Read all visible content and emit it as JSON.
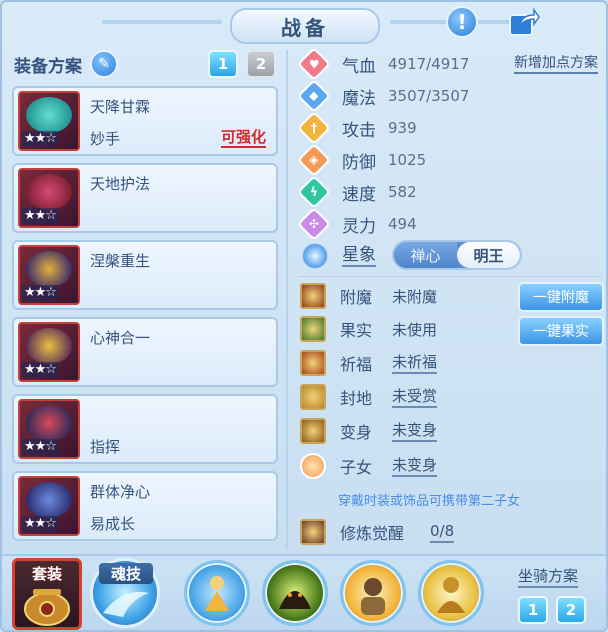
{
  "title": "战备",
  "equip_panel": {
    "label": "装备方案",
    "plan_tabs": [
      "1",
      "2"
    ],
    "items": [
      {
        "name": "天降甘霖",
        "sub": "妙手",
        "upgrade": "可强化",
        "stars": "★★☆",
        "icon": "sword-icon",
        "colors": [
          "#1f8f8f",
          "#62e0d2"
        ]
      },
      {
        "name": "天地护法",
        "sub": "",
        "upgrade": "",
        "stars": "★★☆",
        "icon": "helmet-icon",
        "colors": [
          "#7a1e2e",
          "#d64a7a"
        ]
      },
      {
        "name": "涅槃重生",
        "sub": "",
        "upgrade": "",
        "stars": "★★☆",
        "icon": "armor-icon",
        "colors": [
          "#3a2a6a",
          "#e0b040"
        ]
      },
      {
        "name": "心神合一",
        "sub": "",
        "upgrade": "",
        "stars": "★★☆",
        "icon": "necklace-icon",
        "colors": [
          "#5a2a5a",
          "#e8c040"
        ]
      },
      {
        "name": "",
        "sub": "指挥",
        "upgrade": "",
        "stars": "★★☆",
        "icon": "belt-icon",
        "colors": [
          "#2a2a5a",
          "#d84a5a"
        ]
      },
      {
        "name": "群体净心",
        "sub": "易成长",
        "upgrade": "",
        "stars": "★★☆",
        "icon": "boots-icon",
        "colors": [
          "#2a2a6a",
          "#6a8ae0"
        ]
      }
    ]
  },
  "stats": [
    {
      "label": "气血",
      "value": "4917/4917",
      "color": "#f27a8a",
      "glyph": "♥",
      "icon": "heart-icon"
    },
    {
      "label": "魔法",
      "value": "3507/3507",
      "color": "#5aa8f0",
      "glyph": "◆",
      "icon": "mana-icon"
    },
    {
      "label": "攻击",
      "value": "939",
      "color": "#f2b43a",
      "glyph": "†",
      "icon": "attack-icon"
    },
    {
      "label": "防御",
      "value": "1025",
      "color": "#f29a56",
      "glyph": "◈",
      "icon": "shield-icon"
    },
    {
      "label": "速度",
      "value": "582",
      "color": "#2fc7a0",
      "glyph": "ϟ",
      "icon": "speed-icon"
    },
    {
      "label": "灵力",
      "value": "494",
      "color": "#c78ae8",
      "glyph": "✣",
      "icon": "spirit-icon"
    }
  ],
  "add_points_label": "新增加点方案",
  "star_image": {
    "label": "星象",
    "options": [
      "禅心",
      "明王"
    ],
    "selected": "明王"
  },
  "sections": [
    {
      "label": "附魔",
      "value": "未附魔",
      "underline": false,
      "icon": "enchant-icon",
      "color": "#8a3a1a"
    },
    {
      "label": "果实",
      "value": "未使用",
      "underline": false,
      "icon": "fruit-icon",
      "color": "#3a7a2a"
    },
    {
      "label": "祈福",
      "value": "未祈福",
      "underline": true,
      "icon": "blessing-icon",
      "color": "#a8451a"
    },
    {
      "label": "封地",
      "value": "未受赏",
      "underline": true,
      "icon": "fief-icon",
      "color": "#b8862a"
    },
    {
      "label": "变身",
      "value": "未变身",
      "underline": true,
      "icon": "transform-icon",
      "color": "#8a5a1a"
    },
    {
      "label": "子女",
      "value": "未变身",
      "underline": true,
      "icon": "child-icon",
      "color": "#f29a56"
    },
    {
      "label": "修炼觉醒",
      "value": "0/8",
      "underline": true,
      "icon": "cultivation-icon",
      "color": "#6a3a2a"
    }
  ],
  "enchant_button": "一键附魔",
  "fruit_button": "一键果实",
  "child_hint": "穿戴时装或饰品可携带第二子女",
  "bottom": {
    "suit_label": "套装",
    "soul_label": "魂技",
    "skills": [
      "skill-1-icon",
      "skill-2-icon",
      "skill-3-icon",
      "skill-4-icon"
    ],
    "mount_label": "坐骑方案",
    "mount_tabs": [
      "1",
      "2"
    ]
  }
}
